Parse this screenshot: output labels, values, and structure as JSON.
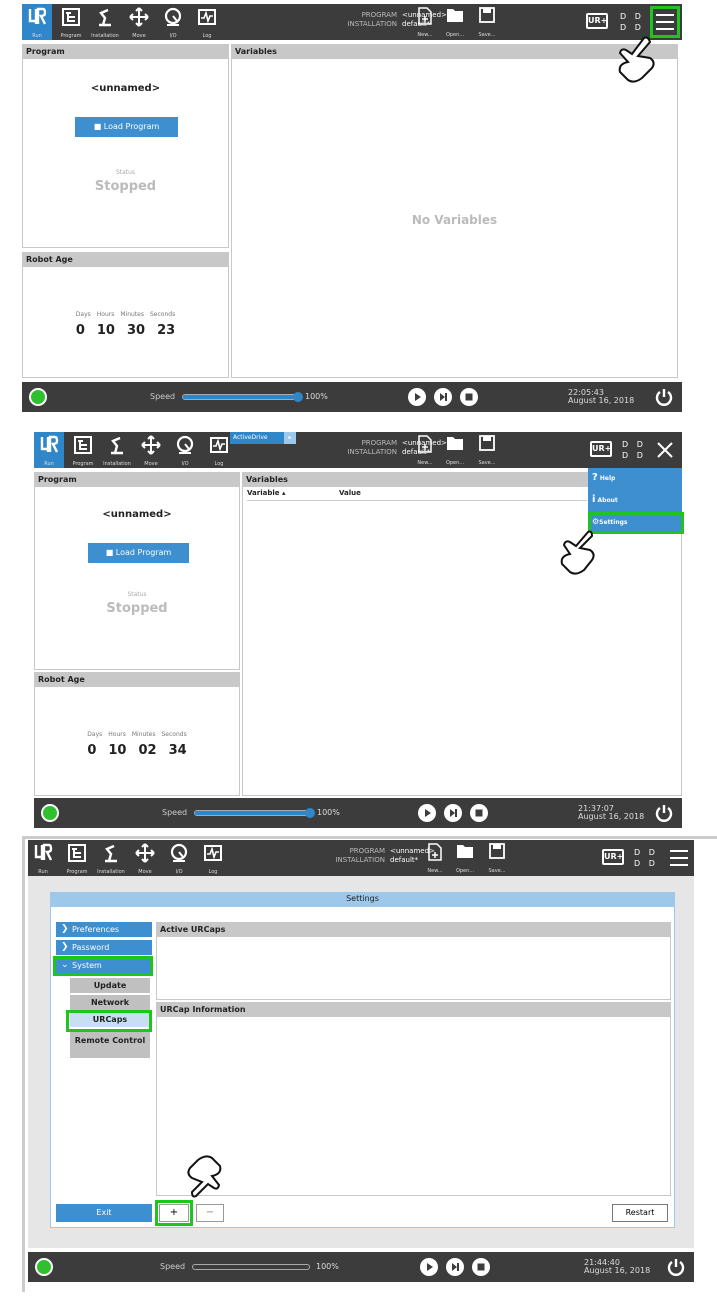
{
  "toolbar": {
    "items": [
      {
        "label": "Run"
      },
      {
        "label": "Program"
      },
      {
        "label": "Installation"
      },
      {
        "label": "Move"
      },
      {
        "label": "I/O"
      },
      {
        "label": "Log"
      }
    ],
    "program_key": "PROGRAM",
    "installation_key": "INSTALLATION",
    "program_value": "<unnamed>",
    "installation_value": "default*",
    "new_label": "New...",
    "open_label": "Open...",
    "save_label": "Save...",
    "urcaps_badge": "UR+",
    "dd_top": "D D",
    "dd_bottom": "D D",
    "activedrive": "ActiveDrive"
  },
  "screen1": {
    "program_header": "Program",
    "variables_header": "Variables",
    "program_name": "<unnamed>",
    "load_button": "Load Program",
    "status_label": "Status",
    "status_value": "Stopped",
    "no_variables": "No Variables",
    "robot_age_header": "Robot Age",
    "age_labels": [
      "Days",
      "Hours",
      "Minutes",
      "Seconds"
    ],
    "age_values": [
      "0",
      "10",
      "30",
      "23"
    ],
    "speed_label": "Speed",
    "speed_value": "100%",
    "speed_fraction": 1.0,
    "time": "22:05:43",
    "date": "August 16, 2018"
  },
  "screen2": {
    "program_header": "Program",
    "variables_header": "Variables",
    "col_variable": "Variable",
    "col_value": "Value",
    "program_name": "<unnamed>",
    "load_button": "Load Program",
    "status_label": "Status",
    "status_value": "Stopped",
    "robot_age_header": "Robot Age",
    "age_labels": [
      "Days",
      "Hours",
      "Minutes",
      "Seconds"
    ],
    "age_values": [
      "0",
      "10",
      "02",
      "34"
    ],
    "menu": {
      "help": "Help",
      "about": "About",
      "settings": "Settings"
    },
    "speed_label": "Speed",
    "speed_value": "100%",
    "speed_fraction": 1.0,
    "time": "21:37:07",
    "date": "August 16, 2018"
  },
  "screen3": {
    "title": "Settings",
    "nav": {
      "preferences": "Preferences",
      "password": "Password",
      "system": "System",
      "update": "Update",
      "network": "Network",
      "urcaps": "URCaps",
      "remote_control": "Remote Control"
    },
    "active_urcaps_header": "Active URCaps",
    "urcap_info_header": "URCap Information",
    "exit_button": "Exit",
    "add_button": "+",
    "remove_button": "−",
    "restart_button": "Restart",
    "speed_label": "Speed",
    "speed_value": "100%",
    "speed_fraction": 0.0,
    "time": "21:44:40",
    "date": "August 16, 2018"
  },
  "colors": {
    "accent": "#2f86c8",
    "highlight": "#1fc41f",
    "toolbar_bg": "#3c3c3c"
  }
}
